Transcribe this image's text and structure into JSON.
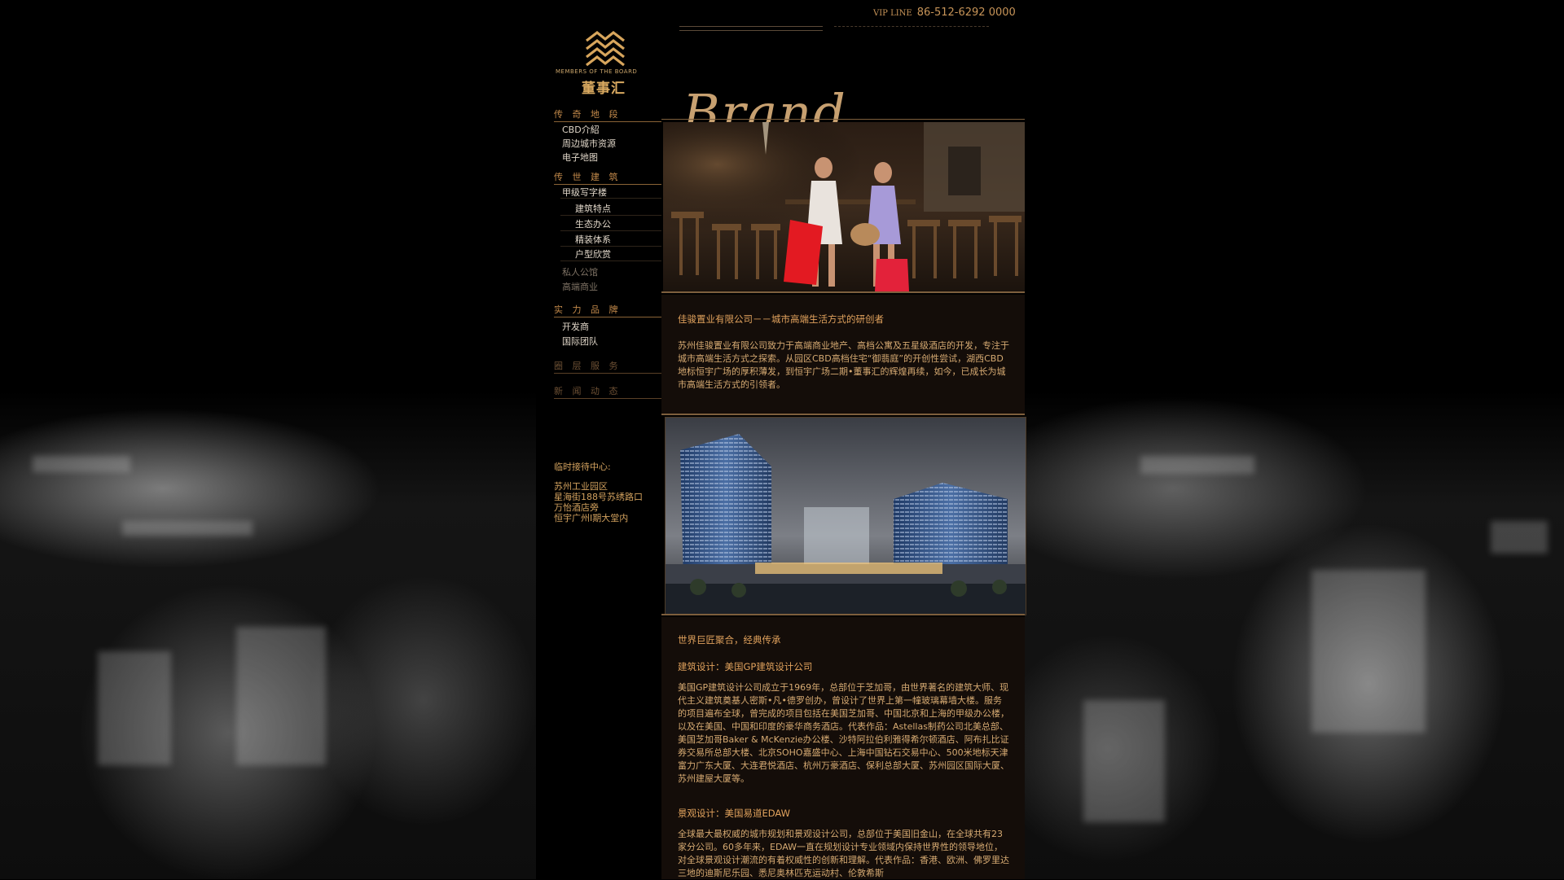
{
  "header": {
    "vip_label": "VIP LINE",
    "vip_phone": "86-512-6292 0000"
  },
  "logo": {
    "subtitle": "MEMBERS OF THE BOARD",
    "name": "董事汇"
  },
  "nav": {
    "sections": [
      {
        "label": "传 奇 地 段",
        "items": [
          "CBD介紹",
          "周边城市资源",
          "电子地图"
        ]
      },
      {
        "label": "传 世 建 筑",
        "items": [
          "甲级写字楼"
        ],
        "subitems": [
          "建筑特点",
          "生态办公",
          "精装体系",
          "户型欣赏"
        ],
        "more_items": [
          "私人公馆",
          "高端商业"
        ]
      },
      {
        "label": "实 力 品 牌",
        "items": [
          "开发商",
          "国际团队"
        ]
      },
      {
        "label": "圈 层 服 务"
      },
      {
        "label": "新 闻 动 态"
      }
    ]
  },
  "contact": {
    "title": "临时接待中心:",
    "lines": [
      "苏州工业园区",
      "星海街188号苏绣路口",
      "万怡酒店旁",
      "恒宇广州Ⅰ期大堂内"
    ]
  },
  "brand_word": "Brand",
  "intro": {
    "title": "佳骏置业有限公司－－城市高端生活方式的研创者",
    "body": "苏州佳骏置业有限公司致力于高端商业地产、高档公寓及五星级酒店的开发，专注于城市高端生活方式之探索。从园区CBD高档住宅“御翡庭”的开创性尝试，湖西CBD地标恒宇广场的厚积薄发，到恒宇广场二期•董事汇的辉煌再续，如今，已成长为城市高端生活方式的引领者。"
  },
  "team": {
    "title": "世界巨匠聚合，经典传承",
    "arch_title": "建筑设计：美国GP建筑设计公司",
    "arch_body": "美国GP建筑设计公司成立于1969年，总部位于芝加哥，由世界著名的建筑大师、现代主义建筑奠基人密斯•凡•德罗创办，曾设计了世界上第一幢玻璃幕墙大楼。服务的项目遍布全球，曾完成的项目包括在美国芝加哥、中国北京和上海的甲级办公楼，以及在美国、中国和印度的豪华商务酒店。代表作品：Astellas制药公司北美总部、美国芝加哥Baker & McKenzie办公楼、沙特阿拉伯利雅得希尔顿酒店、阿布扎比证券交易所总部大楼、北京SOHO嘉盛中心、上海中国钻石交易中心、500米地标天津富力广东大厦、大连君悦酒店、杭州万豪酒店、保利总部大厦、苏州园区国际大厦、苏州建屋大厦等。",
    "land_title": "景观设计：美国易道EDAW",
    "land_body": "全球最大最权威的城市规划和景观设计公司，总部位于美国旧金山，在全球共有23家分公司。60多年来，EDAW一直在规划设计专业领域内保持世界性的领导地位，对全球景观设计潮流的有着权威性的创新和理解。代表作品：香港、欧洲、佛罗里达三地的迪斯尼乐园、悉尼奥林匹克运动村、伦敦希斯"
  },
  "colors": {
    "accent": "#c58b4b",
    "text_gold": "#d6aa72",
    "background": "#000000",
    "content_bg": "#140d09"
  }
}
